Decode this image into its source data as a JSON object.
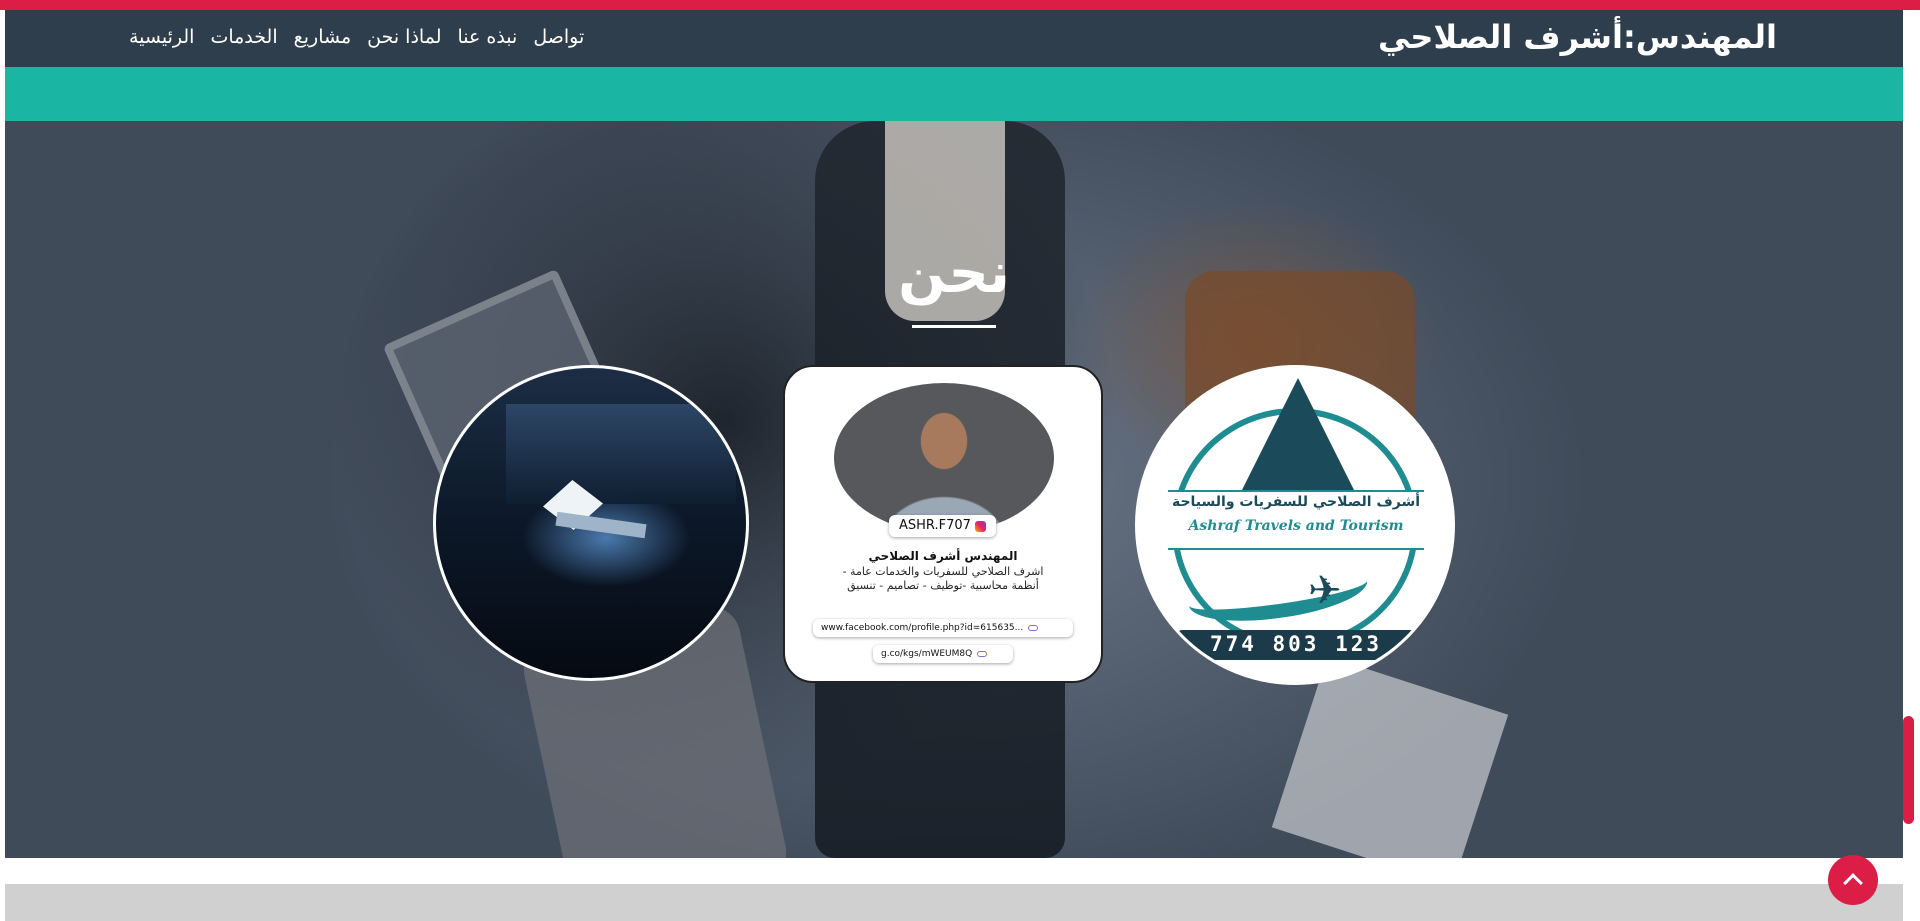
{
  "header": {
    "brand": "المهندس:أشرف الصلاحي",
    "nav": [
      "الرئيسية",
      "الخدمات",
      "مشاريع",
      "لماذا نحن",
      "نبذه عنا",
      "تواصل"
    ]
  },
  "section": {
    "title": "نحن"
  },
  "profile_card": {
    "handle": "ASHR.F707",
    "name": "المهندس أشرف الصلاحي",
    "description_line1": "اشرف الصلاحي للسفريات والخدمات عامة -",
    "description_line2": "أنظمة محاسبية -توظيف - تصاميم - تنسيق",
    "link1": "www.facebook.com/profile.php?id=615635...",
    "link2": "g.co/kgs/mWEUM8Q"
  },
  "logo": {
    "arabic": "أشرف الصلاحي للسفريات والسياحة",
    "english": "Ashraf Travels and Tourism",
    "phone": "774 803 123"
  },
  "colors": {
    "accent": "#dc1d45",
    "navbar": "#2f3e4d",
    "teal": "#1bb5a4"
  },
  "icons": {
    "scroll_top": "chevron-up-icon",
    "instagram": "camera-icon",
    "link": "link-icon"
  }
}
